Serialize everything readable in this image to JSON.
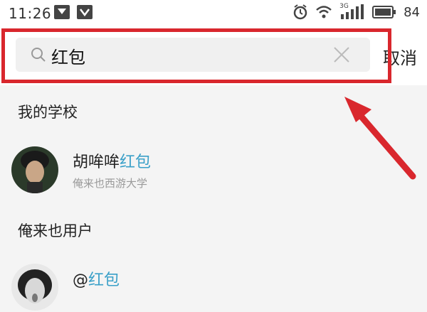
{
  "status_bar": {
    "time": "11:26",
    "network_label": "3G",
    "battery_percent": "84"
  },
  "search": {
    "query": "红包",
    "cancel_label": "取消"
  },
  "sections": [
    {
      "header": "我的学校",
      "result": {
        "name_prefix": "胡哞哞",
        "name_highlight": "红包",
        "subtitle": "俺来也西游大学"
      }
    },
    {
      "header": "俺来也用户",
      "result": {
        "name_prefix": "@",
        "name_highlight": "红包"
      }
    }
  ],
  "colors": {
    "highlight_border": "#d9272d",
    "keyword_highlight": "#3aa0c8",
    "arrow": "#d9272d"
  }
}
